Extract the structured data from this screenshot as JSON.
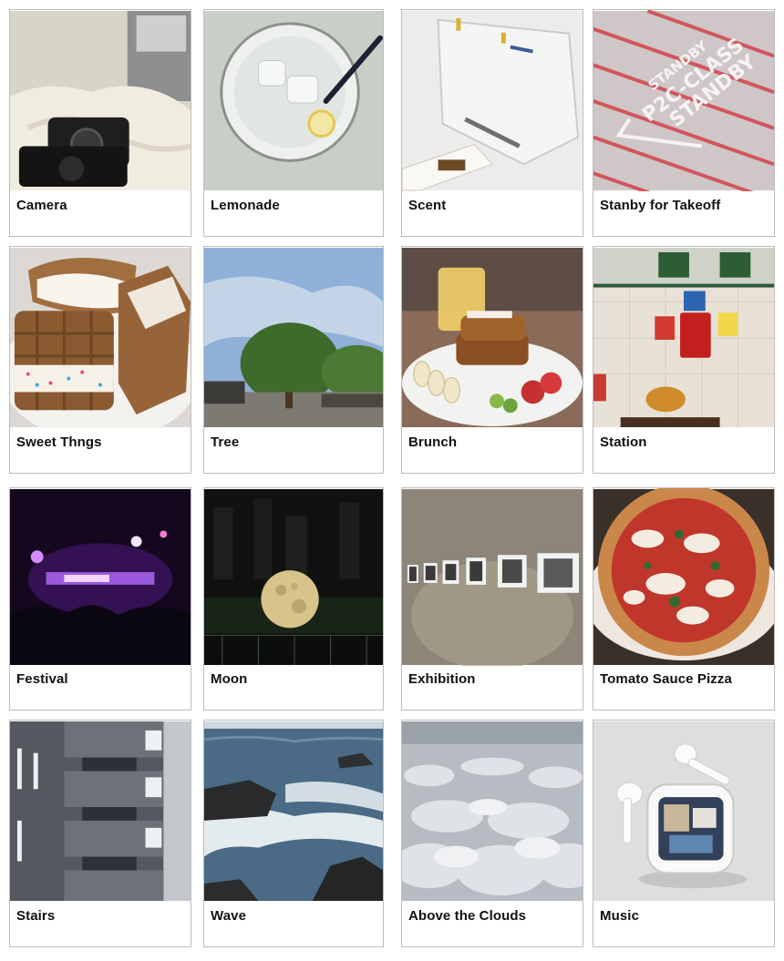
{
  "gallery": {
    "cards": [
      {
        "title": "Camera",
        "image": "camera-photo"
      },
      {
        "title": "Lemonade",
        "image": "lemonade-photo"
      },
      {
        "title": "Scent",
        "image": "scent-photo"
      },
      {
        "title": "Stanby for Takeoff",
        "image": "runway-marking-photo"
      },
      {
        "title": "Sweet Thngs",
        "image": "waffle-dessert-photo"
      },
      {
        "title": "Tree",
        "image": "tree-photo"
      },
      {
        "title": "Brunch",
        "image": "french-toast-photo"
      },
      {
        "title": "Station",
        "image": "station-phone-photo"
      },
      {
        "title": "Festival",
        "image": "concert-photo"
      },
      {
        "title": "Moon",
        "image": "moon-sculpture-photo"
      },
      {
        "title": "Exhibition",
        "image": "gallery-wall-photo"
      },
      {
        "title": "Tomato Sauce Pizza",
        "image": "pizza-photo"
      },
      {
        "title": "Stairs",
        "image": "building-stairs-photo"
      },
      {
        "title": "Wave",
        "image": "ocean-wave-photo"
      },
      {
        "title": "Above the Clouds",
        "image": "clouds-photo"
      },
      {
        "title": "Music",
        "image": "earbuds-photo"
      }
    ]
  }
}
